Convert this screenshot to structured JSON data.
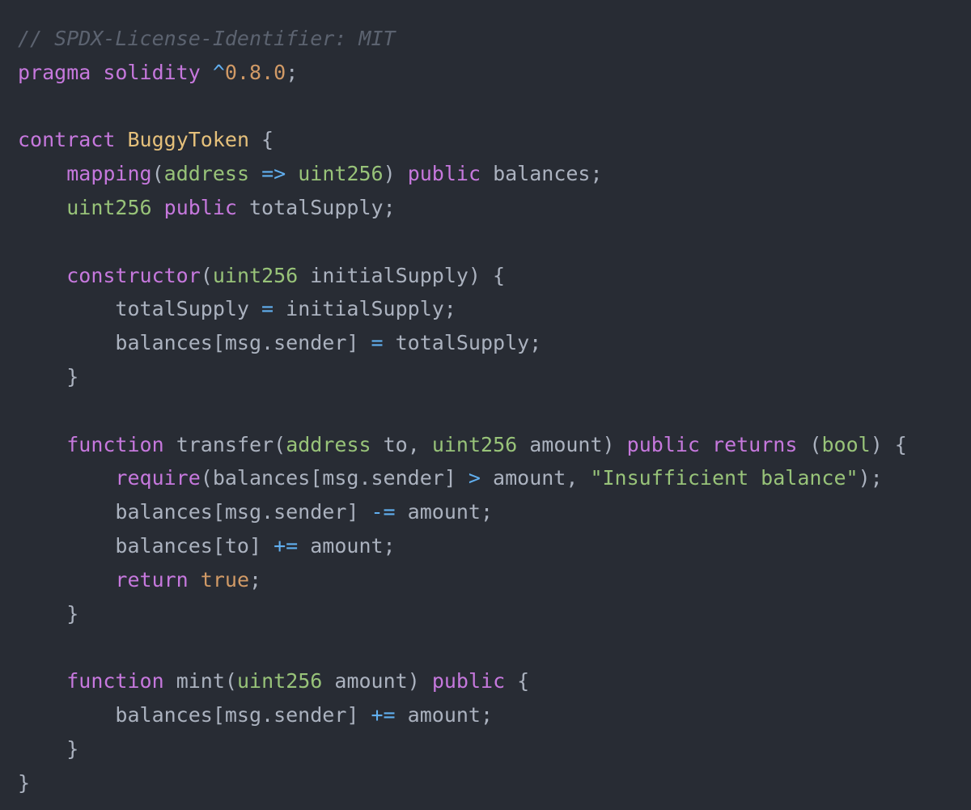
{
  "theme": {
    "background": "#282c34",
    "plain": "#abb2bf",
    "comment": "#5c6370",
    "keyword": "#c678dd",
    "type": "#98c379",
    "string": "#98c379",
    "number": "#d19a66",
    "class": "#e5c07b",
    "function": "#61afef",
    "operator": "#61afef"
  },
  "code": {
    "language": "Solidity",
    "lines": [
      [
        {
          "t": "comment",
          "text": "// SPDX-License-Identifier: MIT"
        }
      ],
      [
        {
          "t": "keyword",
          "text": "pragma"
        },
        {
          "t": "plain",
          "text": " "
        },
        {
          "t": "keyword",
          "text": "solidity"
        },
        {
          "t": "plain",
          "text": " "
        },
        {
          "t": "operator",
          "text": "^"
        },
        {
          "t": "number",
          "text": "0.8.0"
        },
        {
          "t": "plain",
          "text": ";"
        }
      ],
      [],
      [
        {
          "t": "keyword",
          "text": "contract"
        },
        {
          "t": "plain",
          "text": " "
        },
        {
          "t": "class",
          "text": "BuggyToken"
        },
        {
          "t": "plain",
          "text": " {"
        }
      ],
      [
        {
          "t": "plain",
          "text": "    "
        },
        {
          "t": "keyword",
          "text": "mapping"
        },
        {
          "t": "plain",
          "text": "("
        },
        {
          "t": "type",
          "text": "address"
        },
        {
          "t": "plain",
          "text": " "
        },
        {
          "t": "operator",
          "text": "=>"
        },
        {
          "t": "plain",
          "text": " "
        },
        {
          "t": "type",
          "text": "uint256"
        },
        {
          "t": "plain",
          "text": ") "
        },
        {
          "t": "keyword",
          "text": "public"
        },
        {
          "t": "plain",
          "text": " balances;"
        }
      ],
      [
        {
          "t": "plain",
          "text": "    "
        },
        {
          "t": "type",
          "text": "uint256"
        },
        {
          "t": "plain",
          "text": " "
        },
        {
          "t": "keyword",
          "text": "public"
        },
        {
          "t": "plain",
          "text": " totalSupply;"
        }
      ],
      [],
      [
        {
          "t": "plain",
          "text": "    "
        },
        {
          "t": "keyword",
          "text": "constructor"
        },
        {
          "t": "plain",
          "text": "("
        },
        {
          "t": "type",
          "text": "uint256"
        },
        {
          "t": "plain",
          "text": " initialSupply) {"
        }
      ],
      [
        {
          "t": "plain",
          "text": "        totalSupply "
        },
        {
          "t": "operator",
          "text": "="
        },
        {
          "t": "plain",
          "text": " initialSupply;"
        }
      ],
      [
        {
          "t": "plain",
          "text": "        balances[msg.sender] "
        },
        {
          "t": "operator",
          "text": "="
        },
        {
          "t": "plain",
          "text": " totalSupply;"
        }
      ],
      [
        {
          "t": "plain",
          "text": "    }"
        }
      ],
      [],
      [
        {
          "t": "plain",
          "text": "    "
        },
        {
          "t": "keyword",
          "text": "function"
        },
        {
          "t": "plain",
          "text": " "
        },
        {
          "t": "function",
          "text": "transfer"
        },
        {
          "t": "plain",
          "text": "("
        },
        {
          "t": "type",
          "text": "address"
        },
        {
          "t": "plain",
          "text": " to, "
        },
        {
          "t": "type",
          "text": "uint256"
        },
        {
          "t": "plain",
          "text": " amount) "
        },
        {
          "t": "keyword",
          "text": "public"
        },
        {
          "t": "plain",
          "text": " "
        },
        {
          "t": "keyword",
          "text": "returns"
        },
        {
          "t": "plain",
          "text": " ("
        },
        {
          "t": "type",
          "text": "bool"
        },
        {
          "t": "plain",
          "text": ") {"
        }
      ],
      [
        {
          "t": "plain",
          "text": "        "
        },
        {
          "t": "keyword",
          "text": "require"
        },
        {
          "t": "plain",
          "text": "(balances[msg.sender] "
        },
        {
          "t": "operator",
          "text": ">"
        },
        {
          "t": "plain",
          "text": " amount, "
        },
        {
          "t": "string",
          "text": "\"Insufficient balance\""
        },
        {
          "t": "plain",
          "text": ");"
        }
      ],
      [
        {
          "t": "plain",
          "text": "        balances[msg.sender] "
        },
        {
          "t": "operator",
          "text": "-="
        },
        {
          "t": "plain",
          "text": " amount;"
        }
      ],
      [
        {
          "t": "plain",
          "text": "        balances[to] "
        },
        {
          "t": "operator",
          "text": "+="
        },
        {
          "t": "plain",
          "text": " amount;"
        }
      ],
      [
        {
          "t": "plain",
          "text": "        "
        },
        {
          "t": "keyword",
          "text": "return"
        },
        {
          "t": "plain",
          "text": " "
        },
        {
          "t": "bool",
          "text": "true"
        },
        {
          "t": "plain",
          "text": ";"
        }
      ],
      [
        {
          "t": "plain",
          "text": "    }"
        }
      ],
      [],
      [
        {
          "t": "plain",
          "text": "    "
        },
        {
          "t": "keyword",
          "text": "function"
        },
        {
          "t": "plain",
          "text": " "
        },
        {
          "t": "function",
          "text": "mint"
        },
        {
          "t": "plain",
          "text": "("
        },
        {
          "t": "type",
          "text": "uint256"
        },
        {
          "t": "plain",
          "text": " amount) "
        },
        {
          "t": "keyword",
          "text": "public"
        },
        {
          "t": "plain",
          "text": " {"
        }
      ],
      [
        {
          "t": "plain",
          "text": "        balances[msg.sender] "
        },
        {
          "t": "operator",
          "text": "+="
        },
        {
          "t": "plain",
          "text": " amount;"
        }
      ],
      [
        {
          "t": "plain",
          "text": "    }"
        }
      ],
      [
        {
          "t": "plain",
          "text": "}"
        }
      ]
    ]
  }
}
